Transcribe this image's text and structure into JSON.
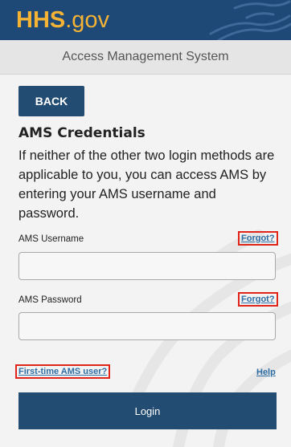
{
  "header": {
    "logo_main": "HHS",
    "logo_suffix": ".gov",
    "subtitle": "Access Management System"
  },
  "back_label": "BACK",
  "section_title": "AMS Credentials",
  "description": "If neither of the other two login methods are applicable to you, you can access AMS by entering your AMS username and password.",
  "username": {
    "label": "AMS Username",
    "forgot": "Forgot?",
    "value": ""
  },
  "password": {
    "label": "AMS Password",
    "forgot": "Forgot?",
    "value": ""
  },
  "first_time_link": "First-time AMS user?",
  "help_link": "Help",
  "login_label": "Login",
  "colors": {
    "brand_blue": "#1e4876",
    "button_blue": "#234c73",
    "logo_gold": "#f5b335",
    "link_blue": "#2e6da4",
    "highlight_red": "#e0241a"
  }
}
